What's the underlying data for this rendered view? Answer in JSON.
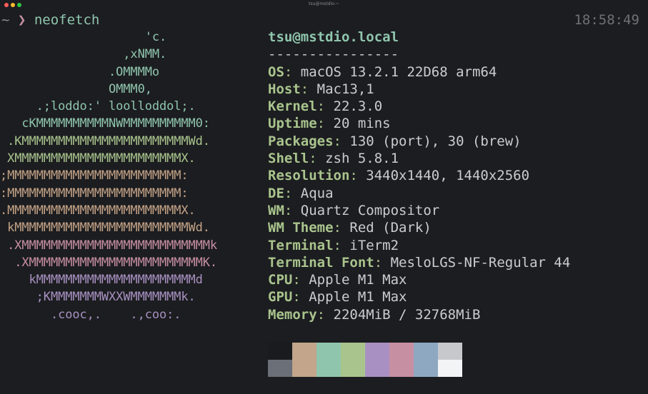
{
  "window": {
    "title": "tsu@mstdio:~"
  },
  "prompt": {
    "tilde": "~",
    "arrow": "❯",
    "command": "neofetch",
    "clock": "18:58:49"
  },
  "logo": [
    {
      "text": "                    'c.",
      "color": "#8fc5ad"
    },
    {
      "text": "                 ,xNMM.",
      "color": "#8fc5ad"
    },
    {
      "text": "               .OMMMMo",
      "color": "#8fc5ad"
    },
    {
      "text": "               OMMM0,",
      "color": "#8fc5ad"
    },
    {
      "text": "     .;loddo:' loolloddol;.",
      "color": "#8fc5ad"
    },
    {
      "text": "   cKMMMMMMMMMMNWMMMMMMMMMM0:",
      "color": "#8fc5ad"
    },
    {
      "text": " .KMMMMMMMMMMMMMMMMMMMMMMMWd.",
      "color": "#a9c48d"
    },
    {
      "text": " XMMMMMMMMMMMMMMMMMMMMMMMX.",
      "color": "#a9c48d"
    },
    {
      "text": ";MMMMMMMMMMMMMMMMMMMMMMMM:",
      "color": "#c4a387"
    },
    {
      "text": ":MMMMMMMMMMMMMMMMMMMMMMMM:",
      "color": "#c4a387"
    },
    {
      "text": ".MMMMMMMMMMMMMMMMMMMMMMMMX.",
      "color": "#c4a387"
    },
    {
      "text": " kMMMMMMMMMMMMMMMMMMMMMMMMWd.",
      "color": "#c4a387"
    },
    {
      "text": " .XMMMMMMMMMMMMMMMMMMMMMMMMMMk",
      "color": "#c78fa2"
    },
    {
      "text": "  .XMMMMMMMMMMMMMMMMMMMMMMMMK.",
      "color": "#c78fa2"
    },
    {
      "text": "    kMMMMMMMMMMMMMMMMMMMMMMd",
      "color": "#a891c2"
    },
    {
      "text": "     ;KMMMMMMMWXXWMMMMMMMk.",
      "color": "#a891c2"
    },
    {
      "text": "       .cooc,.    .,coo:.",
      "color": "#a891c2"
    }
  ],
  "info": {
    "user_host": "tsu@mstdio.local",
    "separator": "----------------",
    "rows": [
      {
        "key": "OS",
        "value": "macOS 13.2.1 22D68 arm64"
      },
      {
        "key": "Host",
        "value": "Mac13,1"
      },
      {
        "key": "Kernel",
        "value": "22.3.0"
      },
      {
        "key": "Uptime",
        "value": "20 mins"
      },
      {
        "key": "Packages",
        "value": "130 (port), 30 (brew)"
      },
      {
        "key": "Shell",
        "value": "zsh 5.8.1"
      },
      {
        "key": "Resolution",
        "value": "3440x1440, 1440x2560"
      },
      {
        "key": "DE",
        "value": "Aqua"
      },
      {
        "key": "WM",
        "value": "Quartz Compositor"
      },
      {
        "key": "WM Theme",
        "value": "Red (Dark)"
      },
      {
        "key": "Terminal",
        "value": "iTerm2"
      },
      {
        "key": "Terminal Font",
        "value": "MesloLGS-NF-Regular 44"
      },
      {
        "key": "CPU",
        "value": "Apple M1 Max"
      },
      {
        "key": "GPU",
        "value": "Apple M1 Max"
      },
      {
        "key": "Memory",
        "value": "2204MiB / 32768MiB"
      }
    ]
  },
  "palette": {
    "top": [
      "#191b1e",
      "#c2a58a",
      "#8fc5ad",
      "#a9c48d",
      "#a891c2",
      "#c78fa2",
      "#8ea8c2",
      "#c6c8cc"
    ],
    "bottom": [
      "#6b7078",
      "#c2a58a",
      "#8fc5ad",
      "#a9c48d",
      "#a891c2",
      "#c78fa2",
      "#8ea8c2",
      "#f3f4f5"
    ]
  },
  "colors": {
    "key": "#a9c48d",
    "user_host": "#8fc5ad",
    "prompt_arrow": "#c78fa2",
    "prompt_text": "#8fc5ad",
    "traffic_close": "#ff5f57",
    "traffic_min": "#febc2e",
    "traffic_max": "#28c840"
  }
}
